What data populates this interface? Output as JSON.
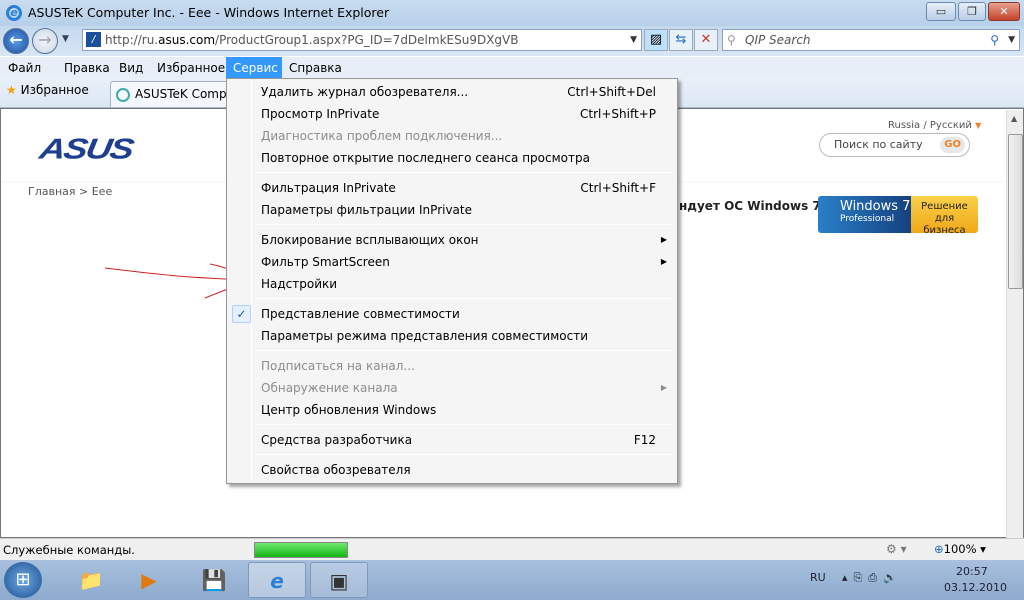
{
  "window": {
    "title": "ASUSTeK Computer Inc. - Eee - Windows Internet Explorer",
    "min": "▭",
    "restore": "❐",
    "close": "✕"
  },
  "nav": {
    "url_prefix": "http://ru.",
    "url_domain": "asus.com",
    "url_path": "/ProductGroup1.aspx?PG_ID=7dDelmkESu9DXgVB",
    "search_placeholder": "QIP Search"
  },
  "menubar": [
    "Файл",
    "Правка",
    "Вид",
    "Избранное",
    "Сервис",
    "Справка"
  ],
  "favorites": {
    "label": "Избранное",
    "tab": "ASUSTeK Computer Inc. - Eee"
  },
  "page": {
    "logo": "ASUS",
    "region": "Russia / Русский",
    "search_placeholder": "Поиск по сайту",
    "go": "GO",
    "breadcrumb": "Главная > Eee",
    "headline": "ндует ОС Windows 7.",
    "banner_left": "Windows 7",
    "banner_sub": "Professional",
    "banner_right": "Решение для бизнеса"
  },
  "menu": {
    "groups": [
      [
        {
          "label": "Удалить журнал обозревателя...",
          "shortcut": "Ctrl+Shift+Del"
        },
        {
          "label": "Просмотр InPrivate",
          "shortcut": "Ctrl+Shift+P"
        },
        {
          "label": "Диагностика проблем подключения...",
          "disabled": true
        },
        {
          "label": "Повторное открытие последнего сеанса просмотра"
        }
      ],
      [
        {
          "label": "Фильтрация InPrivate",
          "shortcut": "Ctrl+Shift+F"
        },
        {
          "label": "Параметры фильтрации InPrivate"
        }
      ],
      [
        {
          "label": "Блокирование всплывающих окон",
          "submenu": true
        },
        {
          "label": "Фильтр SmartScreen",
          "submenu": true
        },
        {
          "label": "Надстройки",
          "highlighted_annotation": true
        }
      ],
      [
        {
          "label": "Представление совместимости",
          "checked": true
        },
        {
          "label": "Параметры режима представления совместимости"
        }
      ],
      [
        {
          "label": "Подписаться на канал...",
          "disabled": true
        },
        {
          "label": "Обнаружение канала",
          "disabled": true,
          "submenu": true
        },
        {
          "label": "Центр обновления Windows"
        }
      ],
      [
        {
          "label": "Средства разработчика",
          "shortcut": "F12"
        }
      ],
      [
        {
          "label": "Свойства обозревателя"
        }
      ]
    ]
  },
  "status": {
    "text": "Служебные команды.",
    "progress": 1.0,
    "zoom": "100%"
  },
  "taskbar": {
    "lang": "RU",
    "time": "20:57",
    "date": "03.12.2010"
  }
}
